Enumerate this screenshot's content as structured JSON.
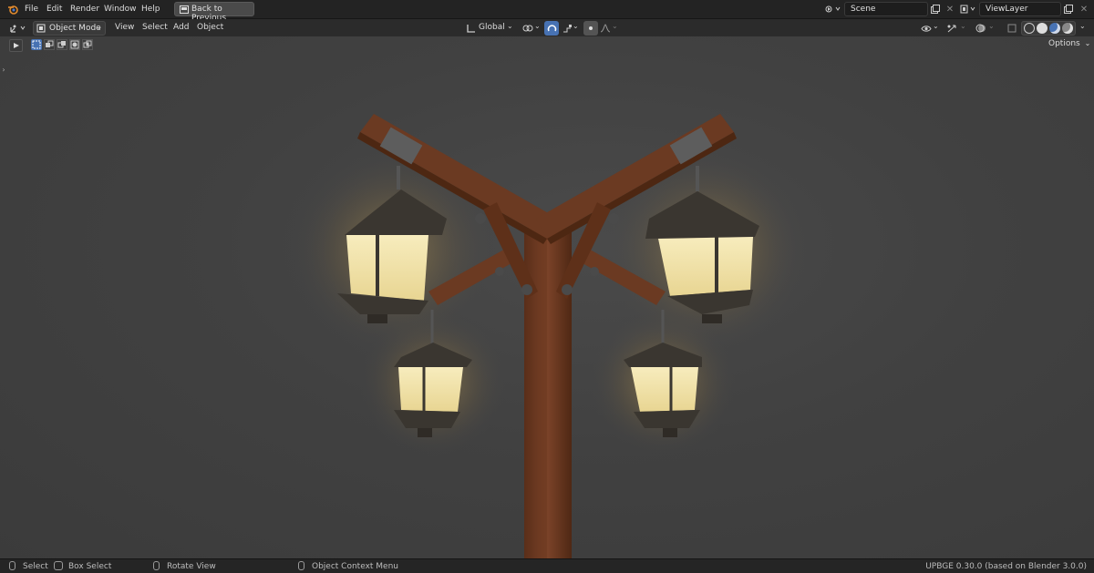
{
  "topbar": {
    "menus": [
      "File",
      "Edit",
      "Render",
      "Window",
      "Help"
    ],
    "back_button": "Back to Previous",
    "scene_field": "Scene",
    "viewlayer_field": "ViewLayer"
  },
  "header": {
    "mode_select": "Object Mode",
    "menus": [
      "View",
      "Select",
      "Add",
      "Object"
    ],
    "transform_orientation": "Global",
    "options_label": "Options"
  },
  "status": {
    "select": "Select",
    "box_select": "Box Select",
    "rotate_view": "Rotate View",
    "context_menu": "Object Context Menu",
    "version": "UPBGE 0.30.0 (based on Blender 3.0.0)"
  },
  "colors": {
    "accent": "#4772b3",
    "lantern_glow": "#f3e6b0",
    "wood": "#6b3a22"
  }
}
